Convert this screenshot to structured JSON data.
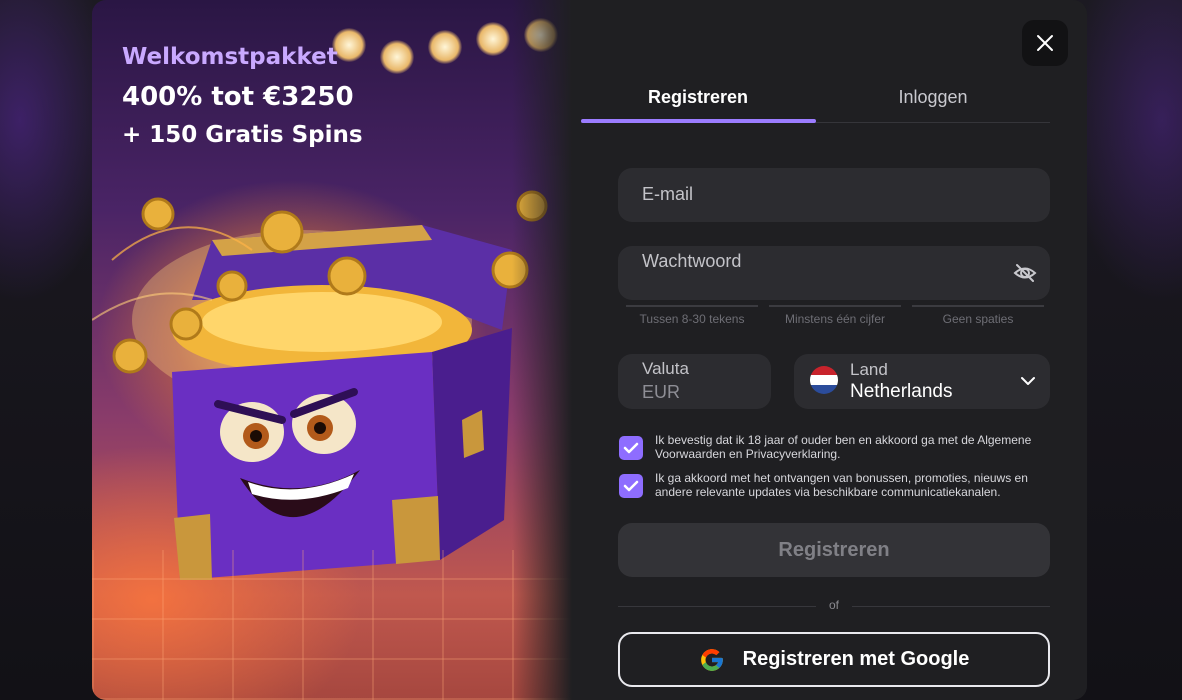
{
  "promo": {
    "subtitle": "Welkomstpakket",
    "headline": "400% tot €3250",
    "spins": "+ 150 Gratis Spins"
  },
  "tabs": [
    {
      "label": "Registreren",
      "active": true
    },
    {
      "label": "Inloggen",
      "active": false
    }
  ],
  "form": {
    "email_placeholder": "E-mail",
    "password_placeholder": "Wachtwoord",
    "password_hints": [
      "Tussen 8-30 tekens",
      "Minstens één cijfer",
      "Geen spaties"
    ],
    "currency_label": "Valuta",
    "currency_value": "EUR",
    "country_label": "Land",
    "country_value": "Netherlands",
    "consent_age": "Ik bevestig dat ik 18 jaar of ouder ben en akkoord ga met de Algemene Voorwaarden en Privacyverklaring.",
    "consent_marketing": "Ik ga akkoord met het ontvangen van bonussen, promoties, nieuws en andere relevante updates via beschikbare communicatiekanalen.",
    "submit_label": "Registreren",
    "divider_text": "of",
    "google_label": "Registreren met Google"
  },
  "icons": {
    "close": "close-icon",
    "eye": "eye-slash-icon",
    "chevron": "chevron-down-icon",
    "check": "check-icon",
    "flag": "netherlands-flag-icon",
    "google": "google-icon"
  },
  "colors": {
    "accent": "#9b7cff",
    "checkbox": "#8e6dff",
    "field_bg": "#2c2c30",
    "panel_bg": "#1f1f22"
  }
}
